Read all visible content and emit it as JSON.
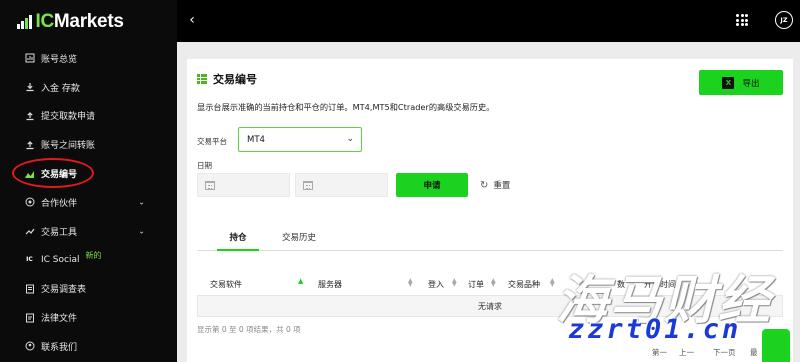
{
  "brand": {
    "logo_text_ic": "IC",
    "logo_text_rest": "Markets",
    "accent": "#1bd21f"
  },
  "sidebar": {
    "items": [
      {
        "label": "账号总览",
        "icon": "report-icon"
      },
      {
        "label": "入金 存款",
        "icon": "download-icon"
      },
      {
        "label": "提交取款申请",
        "icon": "upload-icon"
      },
      {
        "label": "账号之间转账",
        "icon": "transfer-icon"
      },
      {
        "label": "交易编号",
        "icon": "chart-icon",
        "active": true
      },
      {
        "label": "合作伙伴",
        "icon": "partner-icon",
        "expandable": true
      },
      {
        "label": "交易工具",
        "icon": "tools-icon",
        "expandable": true
      },
      {
        "label": "IC Social",
        "icon": "ic-social-icon",
        "badge": "新的"
      },
      {
        "label": "交易调查表",
        "icon": "survey-icon"
      },
      {
        "label": "法律文件",
        "icon": "document-icon"
      },
      {
        "label": "联系我们",
        "icon": "contact-icon"
      }
    ]
  },
  "topbar": {
    "back": "‹",
    "avatar": "JZ"
  },
  "page": {
    "title": "交易编号",
    "export_label": "导出",
    "export_icon": "X",
    "description": "显示台展示准确的当前持仓和平仓的订单。MT4,MT5和Ctrader的高级交易历史。",
    "platform_label": "交易平台",
    "platform_value": "MT4",
    "date_label": "日期",
    "apply_label": "申请",
    "reset_label": "重置"
  },
  "tabs": [
    {
      "label": "持仓",
      "active": true
    },
    {
      "label": "交易历史",
      "active": false
    }
  ],
  "table": {
    "columns": [
      "交易软件",
      "服务器",
      "登入",
      "订单",
      "交易品种",
      "数",
      "开仓时间"
    ],
    "empty_message": "无请求",
    "info": "显示第 0 至 0 项结果，共 0 项",
    "pager": [
      "第一",
      "上一",
      "下一页",
      "最"
    ]
  },
  "watermark": {
    "text": "海马财经",
    "url": "zzrt01.cn"
  }
}
